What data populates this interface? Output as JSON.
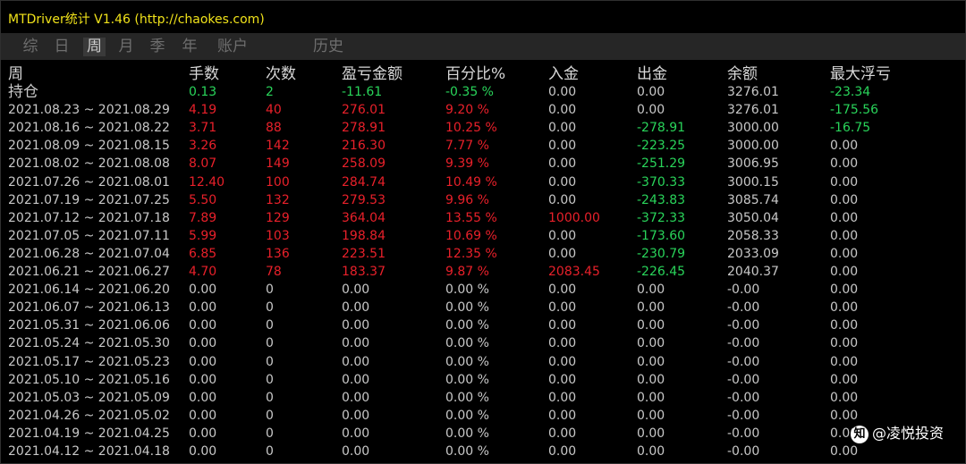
{
  "title": "MTDriver统计 V1.46  (http://chaokes.com)",
  "tabs": [
    {
      "label": "综",
      "active": false
    },
    {
      "label": "日",
      "active": false
    },
    {
      "label": "周",
      "active": true
    },
    {
      "label": "月",
      "active": false
    },
    {
      "label": "季",
      "active": false
    },
    {
      "label": "年",
      "active": false
    },
    {
      "label": "账户",
      "active": false
    },
    {
      "label": "历史",
      "active": false
    }
  ],
  "colors": {
    "neutral": "#c8c8c8",
    "profit": "#e8202a",
    "loss": "#29d45a",
    "title": "#f0e21a"
  },
  "columns": [
    "周",
    "手数",
    "次数",
    "盈亏金额",
    "百分比%",
    "入金",
    "出金",
    "余额",
    "最大浮亏"
  ],
  "position": {
    "label": "持仓",
    "cells": [
      {
        "v": "0.13",
        "c": "loss"
      },
      {
        "v": "2",
        "c": "loss"
      },
      {
        "v": "-11.61",
        "c": "loss"
      },
      {
        "v": "-0.35 %",
        "c": "loss"
      },
      {
        "v": "0.00",
        "c": "neutral"
      },
      {
        "v": "0.00",
        "c": "neutral"
      },
      {
        "v": "3276.01",
        "c": "neutral"
      },
      {
        "v": "-23.34",
        "c": "loss"
      }
    ]
  },
  "rows": [
    {
      "period": "2021.08.23 ~ 2021.08.29",
      "cells": [
        {
          "v": "4.19",
          "c": "profit"
        },
        {
          "v": "40",
          "c": "profit"
        },
        {
          "v": "276.01",
          "c": "profit"
        },
        {
          "v": "9.20 %",
          "c": "profit"
        },
        {
          "v": "0.00",
          "c": "neutral"
        },
        {
          "v": "0.00",
          "c": "neutral"
        },
        {
          "v": "3276.01",
          "c": "neutral"
        },
        {
          "v": "-175.56",
          "c": "loss"
        }
      ]
    },
    {
      "period": "2021.08.16 ~ 2021.08.22",
      "cells": [
        {
          "v": "3.71",
          "c": "profit"
        },
        {
          "v": "88",
          "c": "profit"
        },
        {
          "v": "278.91",
          "c": "profit"
        },
        {
          "v": "10.25 %",
          "c": "profit"
        },
        {
          "v": "0.00",
          "c": "neutral"
        },
        {
          "v": "-278.91",
          "c": "loss"
        },
        {
          "v": "3000.00",
          "c": "neutral"
        },
        {
          "v": "-16.75",
          "c": "loss"
        }
      ]
    },
    {
      "period": "2021.08.09 ~ 2021.08.15",
      "cells": [
        {
          "v": "3.26",
          "c": "profit"
        },
        {
          "v": "142",
          "c": "profit"
        },
        {
          "v": "216.30",
          "c": "profit"
        },
        {
          "v": "7.77 %",
          "c": "profit"
        },
        {
          "v": "0.00",
          "c": "neutral"
        },
        {
          "v": "-223.25",
          "c": "loss"
        },
        {
          "v": "3000.00",
          "c": "neutral"
        },
        {
          "v": "0.00",
          "c": "neutral"
        }
      ]
    },
    {
      "period": "2021.08.02 ~ 2021.08.08",
      "cells": [
        {
          "v": "8.07",
          "c": "profit"
        },
        {
          "v": "149",
          "c": "profit"
        },
        {
          "v": "258.09",
          "c": "profit"
        },
        {
          "v": "9.39 %",
          "c": "profit"
        },
        {
          "v": "0.00",
          "c": "neutral"
        },
        {
          "v": "-251.29",
          "c": "loss"
        },
        {
          "v": "3006.95",
          "c": "neutral"
        },
        {
          "v": "0.00",
          "c": "neutral"
        }
      ]
    },
    {
      "period": "2021.07.26 ~ 2021.08.01",
      "cells": [
        {
          "v": "12.40",
          "c": "profit"
        },
        {
          "v": "100",
          "c": "profit"
        },
        {
          "v": "284.74",
          "c": "profit"
        },
        {
          "v": "10.49 %",
          "c": "profit"
        },
        {
          "v": "0.00",
          "c": "neutral"
        },
        {
          "v": "-370.33",
          "c": "loss"
        },
        {
          "v": "3000.15",
          "c": "neutral"
        },
        {
          "v": "0.00",
          "c": "neutral"
        }
      ]
    },
    {
      "period": "2021.07.19 ~ 2021.07.25",
      "cells": [
        {
          "v": "5.50",
          "c": "profit"
        },
        {
          "v": "132",
          "c": "profit"
        },
        {
          "v": "279.53",
          "c": "profit"
        },
        {
          "v": "9.96 %",
          "c": "profit"
        },
        {
          "v": "0.00",
          "c": "neutral"
        },
        {
          "v": "-243.83",
          "c": "loss"
        },
        {
          "v": "3085.74",
          "c": "neutral"
        },
        {
          "v": "0.00",
          "c": "neutral"
        }
      ]
    },
    {
      "period": "2021.07.12 ~ 2021.07.18",
      "cells": [
        {
          "v": "7.89",
          "c": "profit"
        },
        {
          "v": "129",
          "c": "profit"
        },
        {
          "v": "364.04",
          "c": "profit"
        },
        {
          "v": "13.55 %",
          "c": "profit"
        },
        {
          "v": "1000.00",
          "c": "profit"
        },
        {
          "v": "-372.33",
          "c": "loss"
        },
        {
          "v": "3050.04",
          "c": "neutral"
        },
        {
          "v": "0.00",
          "c": "neutral"
        }
      ]
    },
    {
      "period": "2021.07.05 ~ 2021.07.11",
      "cells": [
        {
          "v": "5.99",
          "c": "profit"
        },
        {
          "v": "103",
          "c": "profit"
        },
        {
          "v": "198.84",
          "c": "profit"
        },
        {
          "v": "10.69 %",
          "c": "profit"
        },
        {
          "v": "0.00",
          "c": "neutral"
        },
        {
          "v": "-173.60",
          "c": "loss"
        },
        {
          "v": "2058.33",
          "c": "neutral"
        },
        {
          "v": "0.00",
          "c": "neutral"
        }
      ]
    },
    {
      "period": "2021.06.28 ~ 2021.07.04",
      "cells": [
        {
          "v": "6.85",
          "c": "profit"
        },
        {
          "v": "136",
          "c": "profit"
        },
        {
          "v": "223.51",
          "c": "profit"
        },
        {
          "v": "12.35 %",
          "c": "profit"
        },
        {
          "v": "0.00",
          "c": "neutral"
        },
        {
          "v": "-230.79",
          "c": "loss"
        },
        {
          "v": "2033.09",
          "c": "neutral"
        },
        {
          "v": "0.00",
          "c": "neutral"
        }
      ]
    },
    {
      "period": "2021.06.21 ~ 2021.06.27",
      "cells": [
        {
          "v": "4.70",
          "c": "profit"
        },
        {
          "v": "78",
          "c": "profit"
        },
        {
          "v": "183.37",
          "c": "profit"
        },
        {
          "v": "9.87 %",
          "c": "profit"
        },
        {
          "v": "2083.45",
          "c": "profit"
        },
        {
          "v": "-226.45",
          "c": "loss"
        },
        {
          "v": "2040.37",
          "c": "neutral"
        },
        {
          "v": "0.00",
          "c": "neutral"
        }
      ]
    },
    {
      "period": "2021.06.14 ~ 2021.06.20",
      "cells": [
        {
          "v": "0.00",
          "c": "neutral"
        },
        {
          "v": "0",
          "c": "neutral"
        },
        {
          "v": "0.00",
          "c": "neutral"
        },
        {
          "v": "0.00 %",
          "c": "neutral"
        },
        {
          "v": "0.00",
          "c": "neutral"
        },
        {
          "v": "0.00",
          "c": "neutral"
        },
        {
          "v": "-0.00",
          "c": "neutral"
        },
        {
          "v": "0.00",
          "c": "neutral"
        }
      ]
    },
    {
      "period": "2021.06.07 ~ 2021.06.13",
      "cells": [
        {
          "v": "0.00",
          "c": "neutral"
        },
        {
          "v": "0",
          "c": "neutral"
        },
        {
          "v": "0.00",
          "c": "neutral"
        },
        {
          "v": "0.00 %",
          "c": "neutral"
        },
        {
          "v": "0.00",
          "c": "neutral"
        },
        {
          "v": "0.00",
          "c": "neutral"
        },
        {
          "v": "-0.00",
          "c": "neutral"
        },
        {
          "v": "0.00",
          "c": "neutral"
        }
      ]
    },
    {
      "period": "2021.05.31 ~ 2021.06.06",
      "cells": [
        {
          "v": "0.00",
          "c": "neutral"
        },
        {
          "v": "0",
          "c": "neutral"
        },
        {
          "v": "0.00",
          "c": "neutral"
        },
        {
          "v": "0.00 %",
          "c": "neutral"
        },
        {
          "v": "0.00",
          "c": "neutral"
        },
        {
          "v": "0.00",
          "c": "neutral"
        },
        {
          "v": "-0.00",
          "c": "neutral"
        },
        {
          "v": "0.00",
          "c": "neutral"
        }
      ]
    },
    {
      "period": "2021.05.24 ~ 2021.05.30",
      "cells": [
        {
          "v": "0.00",
          "c": "neutral"
        },
        {
          "v": "0",
          "c": "neutral"
        },
        {
          "v": "0.00",
          "c": "neutral"
        },
        {
          "v": "0.00 %",
          "c": "neutral"
        },
        {
          "v": "0.00",
          "c": "neutral"
        },
        {
          "v": "0.00",
          "c": "neutral"
        },
        {
          "v": "-0.00",
          "c": "neutral"
        },
        {
          "v": "0.00",
          "c": "neutral"
        }
      ]
    },
    {
      "period": "2021.05.17 ~ 2021.05.23",
      "cells": [
        {
          "v": "0.00",
          "c": "neutral"
        },
        {
          "v": "0",
          "c": "neutral"
        },
        {
          "v": "0.00",
          "c": "neutral"
        },
        {
          "v": "0.00 %",
          "c": "neutral"
        },
        {
          "v": "0.00",
          "c": "neutral"
        },
        {
          "v": "0.00",
          "c": "neutral"
        },
        {
          "v": "-0.00",
          "c": "neutral"
        },
        {
          "v": "0.00",
          "c": "neutral"
        }
      ]
    },
    {
      "period": "2021.05.10 ~ 2021.05.16",
      "cells": [
        {
          "v": "0.00",
          "c": "neutral"
        },
        {
          "v": "0",
          "c": "neutral"
        },
        {
          "v": "0.00",
          "c": "neutral"
        },
        {
          "v": "0.00 %",
          "c": "neutral"
        },
        {
          "v": "0.00",
          "c": "neutral"
        },
        {
          "v": "0.00",
          "c": "neutral"
        },
        {
          "v": "-0.00",
          "c": "neutral"
        },
        {
          "v": "0.00",
          "c": "neutral"
        }
      ]
    },
    {
      "period": "2021.05.03 ~ 2021.05.09",
      "cells": [
        {
          "v": "0.00",
          "c": "neutral"
        },
        {
          "v": "0",
          "c": "neutral"
        },
        {
          "v": "0.00",
          "c": "neutral"
        },
        {
          "v": "0.00 %",
          "c": "neutral"
        },
        {
          "v": "0.00",
          "c": "neutral"
        },
        {
          "v": "0.00",
          "c": "neutral"
        },
        {
          "v": "-0.00",
          "c": "neutral"
        },
        {
          "v": "0.00",
          "c": "neutral"
        }
      ]
    },
    {
      "period": "2021.04.26 ~ 2021.05.02",
      "cells": [
        {
          "v": "0.00",
          "c": "neutral"
        },
        {
          "v": "0",
          "c": "neutral"
        },
        {
          "v": "0.00",
          "c": "neutral"
        },
        {
          "v": "0.00 %",
          "c": "neutral"
        },
        {
          "v": "0.00",
          "c": "neutral"
        },
        {
          "v": "0.00",
          "c": "neutral"
        },
        {
          "v": "-0.00",
          "c": "neutral"
        },
        {
          "v": "0.00",
          "c": "neutral"
        }
      ]
    },
    {
      "period": "2021.04.19 ~ 2021.04.25",
      "cells": [
        {
          "v": "0.00",
          "c": "neutral"
        },
        {
          "v": "0",
          "c": "neutral"
        },
        {
          "v": "0.00",
          "c": "neutral"
        },
        {
          "v": "0.00 %",
          "c": "neutral"
        },
        {
          "v": "0.00",
          "c": "neutral"
        },
        {
          "v": "0.00",
          "c": "neutral"
        },
        {
          "v": "-0.00",
          "c": "neutral"
        },
        {
          "v": "0.00",
          "c": "neutral"
        }
      ]
    },
    {
      "period": "2021.04.12 ~ 2021.04.18",
      "cells": [
        {
          "v": "0.00",
          "c": "neutral"
        },
        {
          "v": "0",
          "c": "neutral"
        },
        {
          "v": "0.00",
          "c": "neutral"
        },
        {
          "v": "0.00 %",
          "c": "neutral"
        },
        {
          "v": "0.00",
          "c": "neutral"
        },
        {
          "v": "0.00",
          "c": "neutral"
        },
        {
          "v": "-0.00",
          "c": "neutral"
        },
        {
          "v": "0.00",
          "c": "neutral"
        }
      ]
    }
  ],
  "watermark": {
    "icon": "zhihu-logo-icon",
    "text": "@凌悦投资"
  }
}
